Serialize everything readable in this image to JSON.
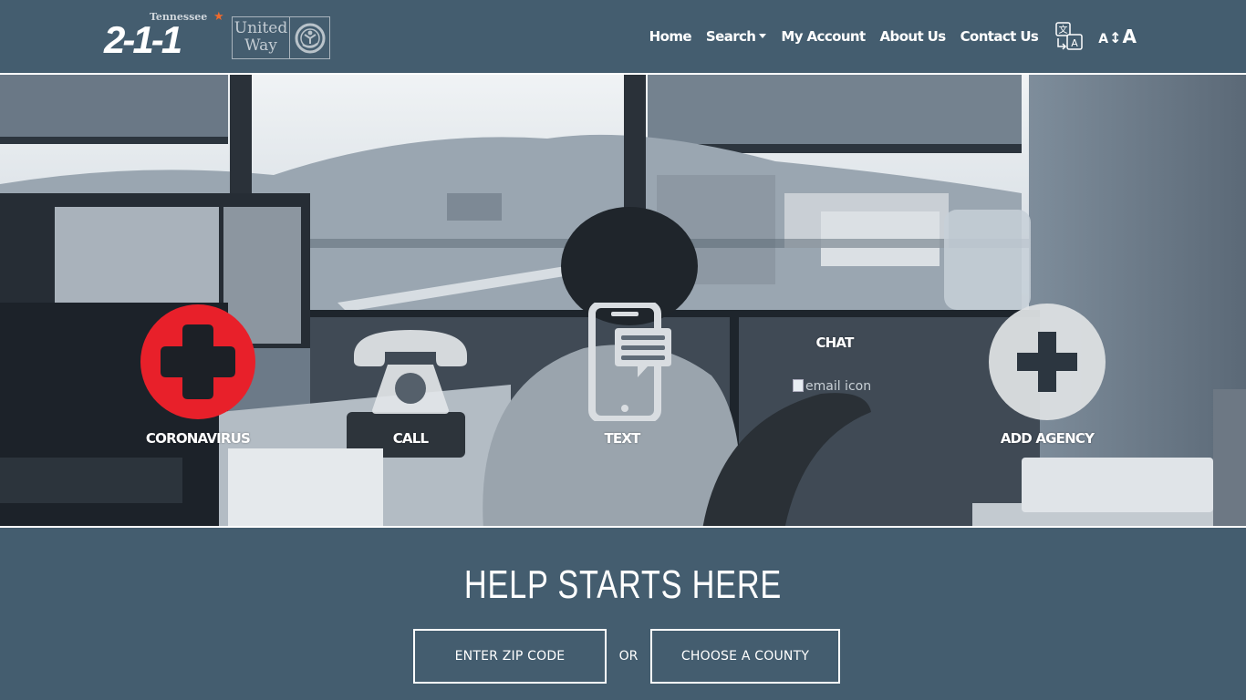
{
  "header": {
    "logo_state": "Tennessee",
    "logo_number": "2-1-1",
    "partner_logo_line1": "United",
    "partner_logo_line2": "Way",
    "nav": [
      {
        "label": "Home"
      },
      {
        "label": "Search",
        "has_dropdown": true
      },
      {
        "label": "My Account"
      },
      {
        "label": "About Us"
      },
      {
        "label": "Contact Us"
      }
    ],
    "translate_icon": "translate-icon",
    "text_size": {
      "small": "A",
      "arrow": "↕",
      "big": "A"
    }
  },
  "hero": {
    "actions": [
      {
        "label": "CORONAVIRUS",
        "icon": "red-cross-icon"
      },
      {
        "label": "CALL",
        "icon": "telephone-icon"
      },
      {
        "label": "TEXT",
        "icon": "mobile-message-icon"
      },
      {
        "label": "CHAT",
        "icon": "email-icon",
        "broken_alt": "email icon"
      },
      {
        "label": "ADD AGENCY",
        "icon": "plus-circle-icon"
      }
    ]
  },
  "search": {
    "headline": "HELP STARTS HERE",
    "zip_button": "ENTER ZIP CODE",
    "or_label": "OR",
    "county_button": "CHOOSE A COUNTY"
  },
  "colors": {
    "brand_bg": "#445d6f",
    "corona_red": "#e8202a",
    "star_orange": "#f06a2c"
  }
}
